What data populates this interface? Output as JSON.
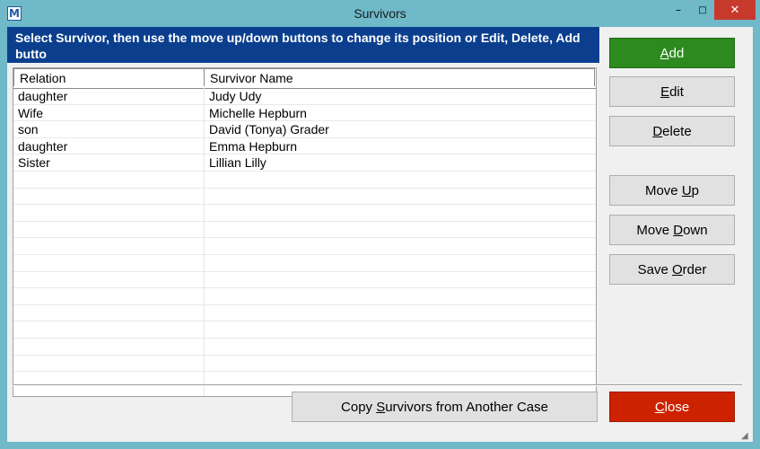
{
  "window": {
    "title": "Survivors",
    "app_icon_letter": "M",
    "controls": {
      "minimize": "–",
      "maximize": "□",
      "close": "✕"
    }
  },
  "instruction": "Select Survivor, then use the move up/down buttons to change its position or Edit, Delete, Add butto",
  "table": {
    "columns": [
      "Relation",
      "Survivor Name"
    ],
    "rows": [
      {
        "relation": "daughter",
        "name": "Judy Udy"
      },
      {
        "relation": "Wife",
        "name": "Michelle Hepburn"
      },
      {
        "relation": "son",
        "name": "David (Tonya) Grader"
      },
      {
        "relation": "daughter",
        "name": "Emma Hepburn"
      },
      {
        "relation": "Sister",
        "name": "Lillian Lilly"
      }
    ],
    "empty_rows": 12
  },
  "buttons": {
    "add": {
      "pre": "",
      "u": "A",
      "post": "dd",
      "color": "#2d8a1e"
    },
    "edit": {
      "pre": "",
      "u": "E",
      "post": "dit"
    },
    "delete": {
      "pre": "",
      "u": "D",
      "post": "elete"
    },
    "move_up": {
      "pre": "Move ",
      "u": "U",
      "post": "p"
    },
    "move_down": {
      "pre": "Move ",
      "u": "D",
      "post": "own"
    },
    "save_order": {
      "pre": "Save ",
      "u": "O",
      "post": "rder"
    },
    "copy": {
      "pre": "Copy ",
      "u": "S",
      "post": "urvivors from Another Case"
    },
    "close": {
      "pre": "",
      "u": "C",
      "post": "lose",
      "color": "#cc2200"
    }
  },
  "colors": {
    "instruction_bg": "#0b3f8e",
    "window_frame": "#6fb9c8"
  },
  "icons": {
    "resize_grip": "resize-grip-icon",
    "app": "app-icon"
  }
}
